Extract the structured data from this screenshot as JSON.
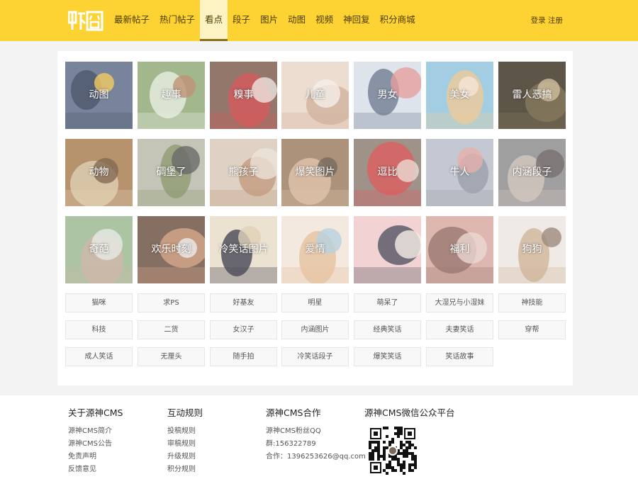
{
  "header": {
    "logo_text": "虾囧",
    "nav": [
      "最新帖子",
      "热门帖子",
      "看点",
      "段子",
      "图片",
      "动图",
      "视频",
      "神回复",
      "积分商城"
    ],
    "active_index": 2,
    "login": "登录",
    "register": "注册"
  },
  "tiles": [
    {
      "label": "动图",
      "colors": [
        "#5a6a86",
        "#2b3750",
        "#f0c040"
      ]
    },
    {
      "label": "趣事",
      "colors": [
        "#8fa874",
        "#dfe7d6",
        "#b07a58"
      ]
    },
    {
      "label": "糗事",
      "colors": [
        "#7a5a4a",
        "#c83a3a",
        "#e8e0d8"
      ]
    },
    {
      "label": "儿童",
      "colors": [
        "#e9d6c6",
        "#c9a48c",
        "#f2ebe4"
      ]
    },
    {
      "label": "男女",
      "colors": [
        "#d8dfe8",
        "#5a6a80",
        "#e08a8a"
      ]
    },
    {
      "label": "美女",
      "colors": [
        "#8fc3dd",
        "#e6c08a",
        "#f4e0cf"
      ]
    },
    {
      "label": "雷人恶搞",
      "colors": [
        "#3a3020",
        "#6a5a3a",
        "#c8b08a"
      ]
    },
    {
      "label": "动物",
      "colors": [
        "#a67a4e",
        "#d6c3a0",
        "#6a4a2e"
      ]
    },
    {
      "label": "碉堡了",
      "colors": [
        "#b8b8a8",
        "#7a8a5a",
        "#4a4a4a"
      ]
    },
    {
      "label": "熊孩子",
      "colors": [
        "#d8c8b8",
        "#b88a6a",
        "#e8ddd2"
      ]
    },
    {
      "label": "爆笑图片",
      "colors": [
        "#9a7a5e",
        "#d6b496",
        "#5a4a3a"
      ]
    },
    {
      "label": "逗比",
      "colors": [
        "#8a7a70",
        "#d04040",
        "#e4d4c8"
      ]
    },
    {
      "label": "牛人",
      "colors": [
        "#b8bcc8",
        "#8a8e9a",
        "#e0a09a"
      ]
    },
    {
      "label": "内涵段子",
      "colors": [
        "#8a8a8a",
        "#c8b8b0",
        "#5a5050"
      ]
    },
    {
      "label": "奇葩",
      "colors": [
        "#9ab890",
        "#c4a898",
        "#e2e6e0"
      ]
    },
    {
      "label": "欢乐时刻",
      "colors": [
        "#6a5040",
        "#c89070",
        "#e8e8e8"
      ]
    },
    {
      "label": "冷笑话图片",
      "colors": [
        "#e8dcc8",
        "#2a2a3a",
        "#d8c8a8"
      ]
    },
    {
      "label": "爱情",
      "colors": [
        "#f2e4d8",
        "#e0b890",
        "#a8c8d8"
      ]
    },
    {
      "label": "",
      "colors": [
        "#f0c8c8",
        "#3a3a4a",
        "#f4e8e0"
      ]
    },
    {
      "label": "福利",
      "colors": [
        "#d8a8a0",
        "#8a6058",
        "#e8d0c8"
      ]
    },
    {
      "label": "狗狗",
      "colors": [
        "#ece6e0",
        "#c8a888",
        "#8a7060"
      ]
    }
  ],
  "tags": [
    "猫咪",
    "求PS",
    "好基友",
    "明星",
    "萌呆了",
    "大湿兄与小湿妹",
    "神技能",
    "科技",
    "二货",
    "女汉子",
    "内涵图片",
    "经典笑话",
    "夫妻笑话",
    "穿帮",
    "成人笑话",
    "无厘头",
    "随手拍",
    "冷笑话段子",
    "爆笑笑话",
    "笑话故事"
  ],
  "footer": {
    "cols": [
      {
        "title": "关于源神CMS",
        "items": [
          "源神CMS简介",
          "源神CMS公告",
          "免责声明",
          "反馈意见"
        ]
      },
      {
        "title": "互动规则",
        "items": [
          "投稿规则",
          "审稿规则",
          "升级规则",
          "积分规则"
        ]
      },
      {
        "title": "源神CMS合作",
        "items": [
          "源神CMS粉丝QQ",
          "群:156322789",
          "合作：1396253626@qq.com"
        ]
      },
      {
        "title": "源神CMS微信公众平台",
        "items": []
      }
    ]
  },
  "colors": {
    "header": "#fdd333",
    "nav_text": "#4a3a00",
    "active_bg": "#fef3c2"
  }
}
